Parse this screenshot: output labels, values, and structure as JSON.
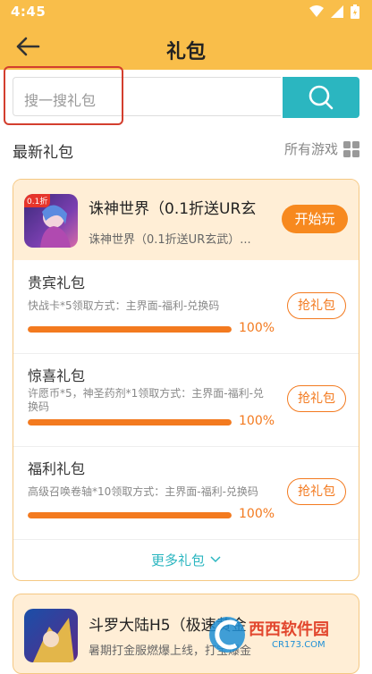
{
  "status_bar": {
    "time": "4:45"
  },
  "app_bar": {
    "title": "礼包"
  },
  "search": {
    "placeholder": "搜一搜礼包"
  },
  "section": {
    "title": "最新礼包",
    "all_games_label": "所有游戏"
  },
  "games": [
    {
      "name": "诛神世界（0.1折送UR玄",
      "subtitle": "诛神世界（0.1折送UR玄武）...",
      "icon_badge": "0.1折",
      "play_label": "开始玩",
      "gifts": [
        {
          "name": "贵宾礼包",
          "desc": "快战卡*5领取方式：主界面-福利-兑换码",
          "progress_pct": 100,
          "progress_label": "100%",
          "button_label": "抢礼包"
        },
        {
          "name": "惊喜礼包",
          "desc": "许愿币*5，神圣药剂*1领取方式：主界面-福利-兑换码",
          "progress_pct": 100,
          "progress_label": "100%",
          "button_label": "抢礼包"
        },
        {
          "name": "福利礼包",
          "desc": "高级召唤卷轴*10领取方式：主界面-福利-兑换码",
          "progress_pct": 100,
          "progress_label": "100%",
          "button_label": "抢礼包"
        }
      ],
      "more_label": "更多礼包"
    },
    {
      "name": "斗罗大陆H5（极速黄金",
      "subtitle": "暑期打金服燃爆上线，打宝爆金"
    }
  ],
  "watermark": {
    "text": "西西软件园",
    "url_text": "CR173.COM"
  },
  "colors": {
    "header": "#F9BE4A",
    "accent": "#F37A1F",
    "teal": "#2BB6C0",
    "card_bg": "#FFEED6",
    "highlight": "#D33E2E"
  }
}
